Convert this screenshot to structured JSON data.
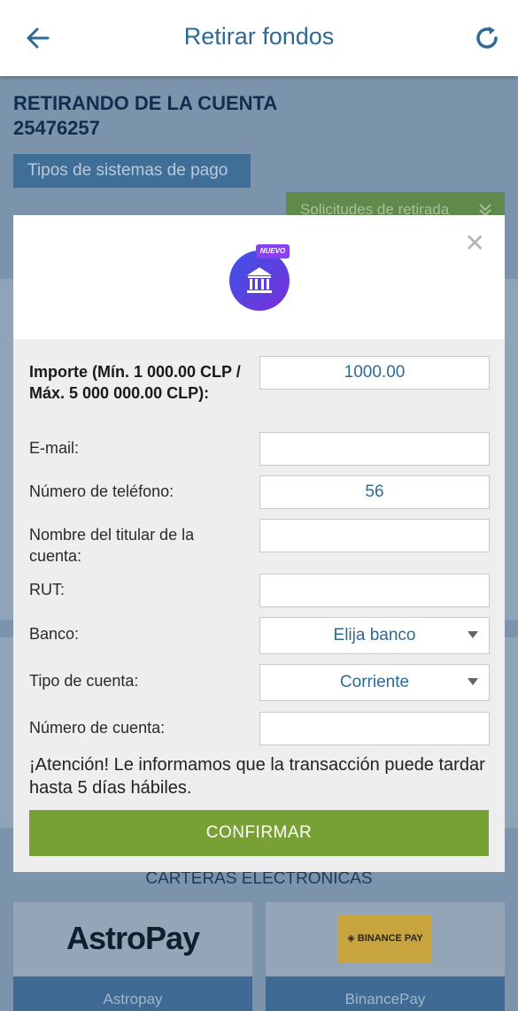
{
  "header": {
    "title": "Retirar fondos",
    "back_icon": "arrow-left-icon",
    "refresh_icon": "refresh-icon"
  },
  "background": {
    "account_line1": "RETIRANDO DE LA CUENTA",
    "account_line2": "25476257",
    "pay_types_label": "Tipos de sistemas de pago",
    "requests_label": "Solicitudes de retirada",
    "wallets_title": "CARTERAS ELECTRONICAS",
    "wallets": [
      {
        "logo": "AstroPay",
        "name": "Astropay"
      },
      {
        "logo": "◈ BINANCE PAY",
        "name": "BinancePay"
      }
    ]
  },
  "modal": {
    "badge": "NUEVO",
    "close_label": "✕",
    "amount_label": "Importe (Mín. 1 000.00 CLP / Máx. 5 000 000.00 CLP):",
    "amount_value": "1000.00",
    "email_label": "E-mail:",
    "email_value": "",
    "phone_label": "Número de teléfono:",
    "phone_value": "56",
    "holder_label": "Nombre del titular de la cuenta:",
    "holder_value": "",
    "rut_label": "RUT:",
    "rut_value": "",
    "bank_label": "Banco:",
    "bank_value": "Elija banco",
    "account_type_label": "Tipo de cuenta:",
    "account_type_value": "Corriente",
    "account_number_label": "Número de cuenta:",
    "account_number_value": "",
    "notice": "¡Atención! Le informamos que la transacción puede tardar hasta 5 días hábiles.",
    "confirm_label": "CONFIRMAR"
  }
}
